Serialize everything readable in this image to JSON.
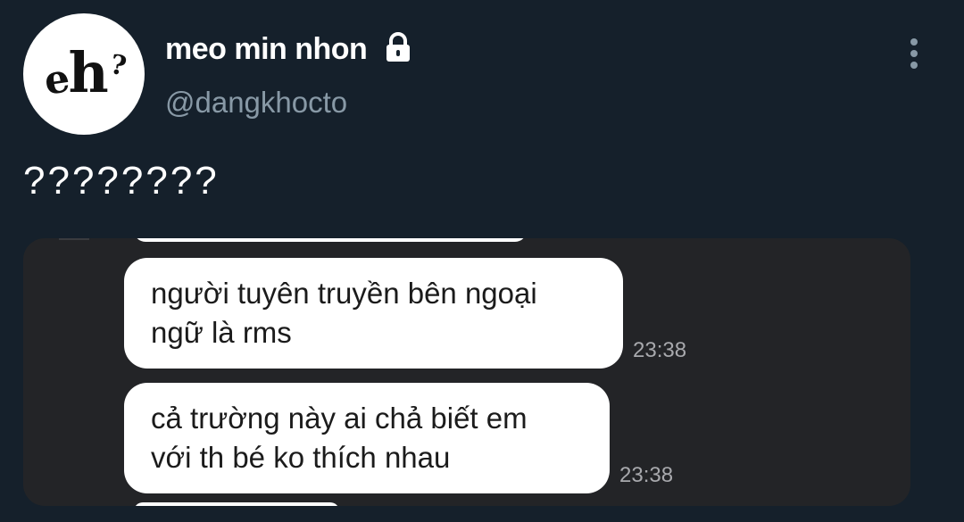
{
  "profile": {
    "avatar_text": {
      "e": "e",
      "h": "h",
      "q": "?"
    },
    "display_name": "meo min nhon",
    "protected_icon": "lock-icon",
    "handle": "@dangkhocto",
    "menu_icon": "more-vertical-icon"
  },
  "tweet": {
    "text": "????????"
  },
  "media": {
    "messages": [
      {
        "text_line1": "người tuyên truyền bên ngoại",
        "text_line2": "ngữ là rms",
        "time": "23:38"
      },
      {
        "text_line1": "cả trường này ai chả biết em",
        "text_line2": "với th bé ko thích nhau",
        "time": "23:38"
      }
    ]
  },
  "colors": {
    "background": "#15202b",
    "secondary_text": "#8899a6",
    "media_background": "#232427",
    "bubble": "#ffffff"
  }
}
